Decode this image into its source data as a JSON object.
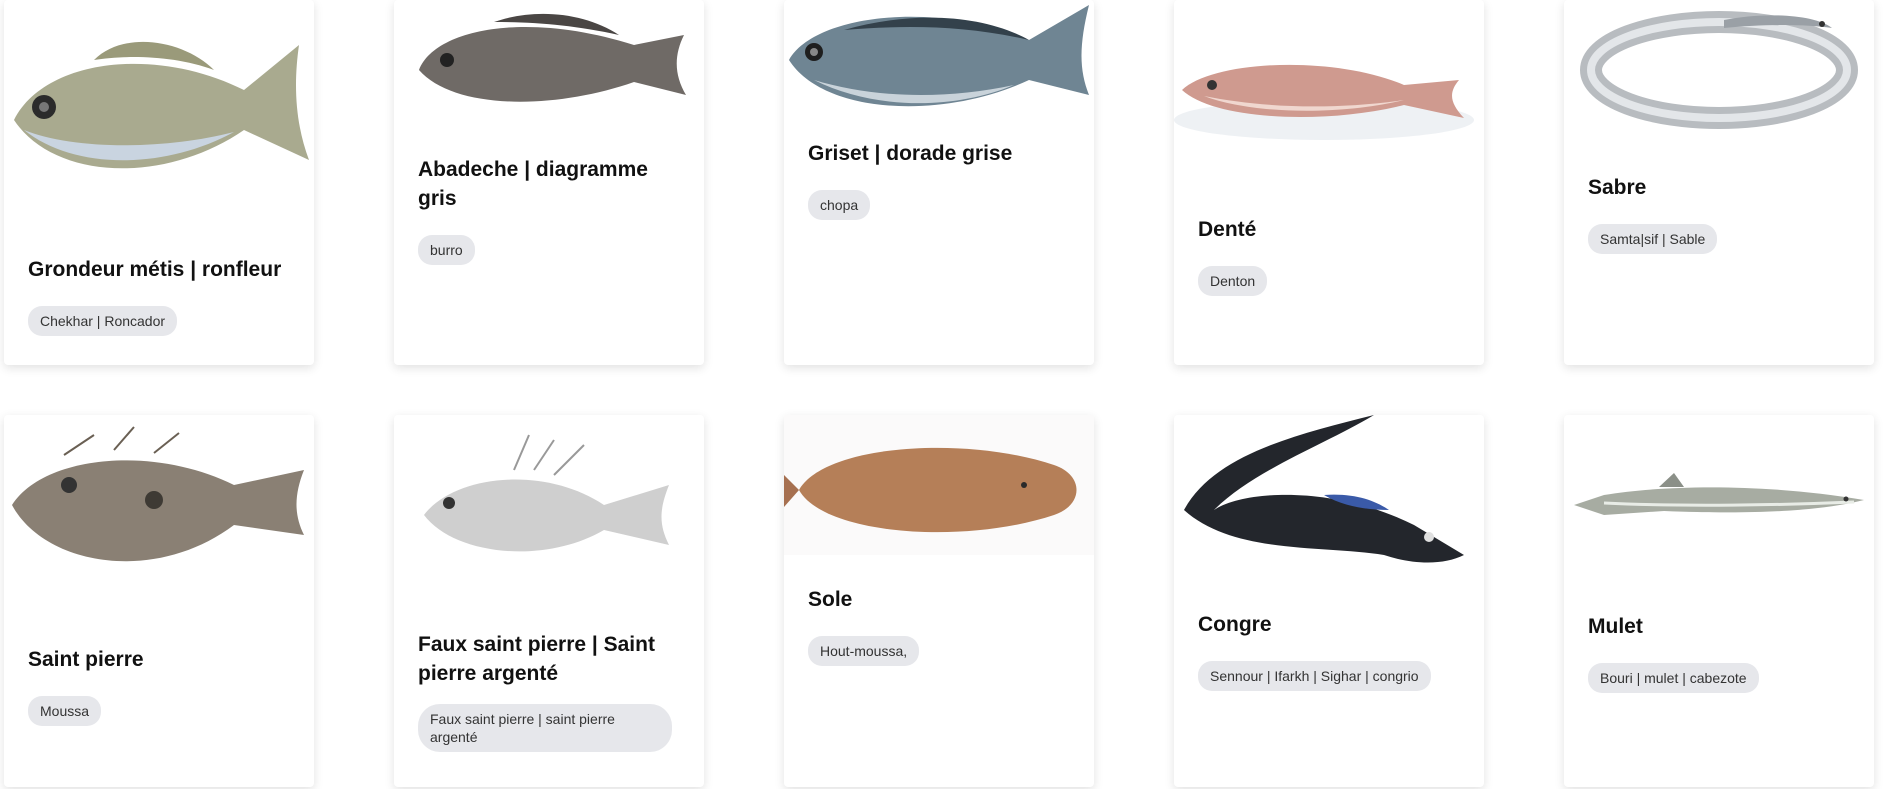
{
  "cards": [
    {
      "title": "Grondeur métis | ronfleur",
      "tag": "Chekhar | Roncador",
      "image": "grondeur-fish-image"
    },
    {
      "title": "Abadeche | diagramme gris",
      "tag": "burro",
      "image": "abadeche-fish-image"
    },
    {
      "title": "Griset | dorade grise",
      "tag": "chopa",
      "image": "griset-fish-image"
    },
    {
      "title": "Denté",
      "tag": "Denton",
      "image": "dente-fish-image"
    },
    {
      "title": "Sabre",
      "tag": "Samta|sif | Sable",
      "image": "sabre-fish-image"
    },
    {
      "title": "Saint pierre",
      "tag": "Moussa",
      "image": "saint-pierre-fish-image"
    },
    {
      "title": "Faux saint pierre | Saint pierre argenté",
      "tag": "Faux saint pierre | saint pierre argenté",
      "image": "faux-saint-pierre-fish-image"
    },
    {
      "title": "Sole",
      "tag": "Hout-moussa,",
      "image": "sole-fish-image"
    },
    {
      "title": "Congre",
      "tag": "Sennour | Ifarkh | Sighar | congrio",
      "image": "congre-fish-image"
    },
    {
      "title": "Mulet",
      "tag": "Bouri | mulet | cabezote",
      "image": "mulet-fish-image"
    }
  ]
}
